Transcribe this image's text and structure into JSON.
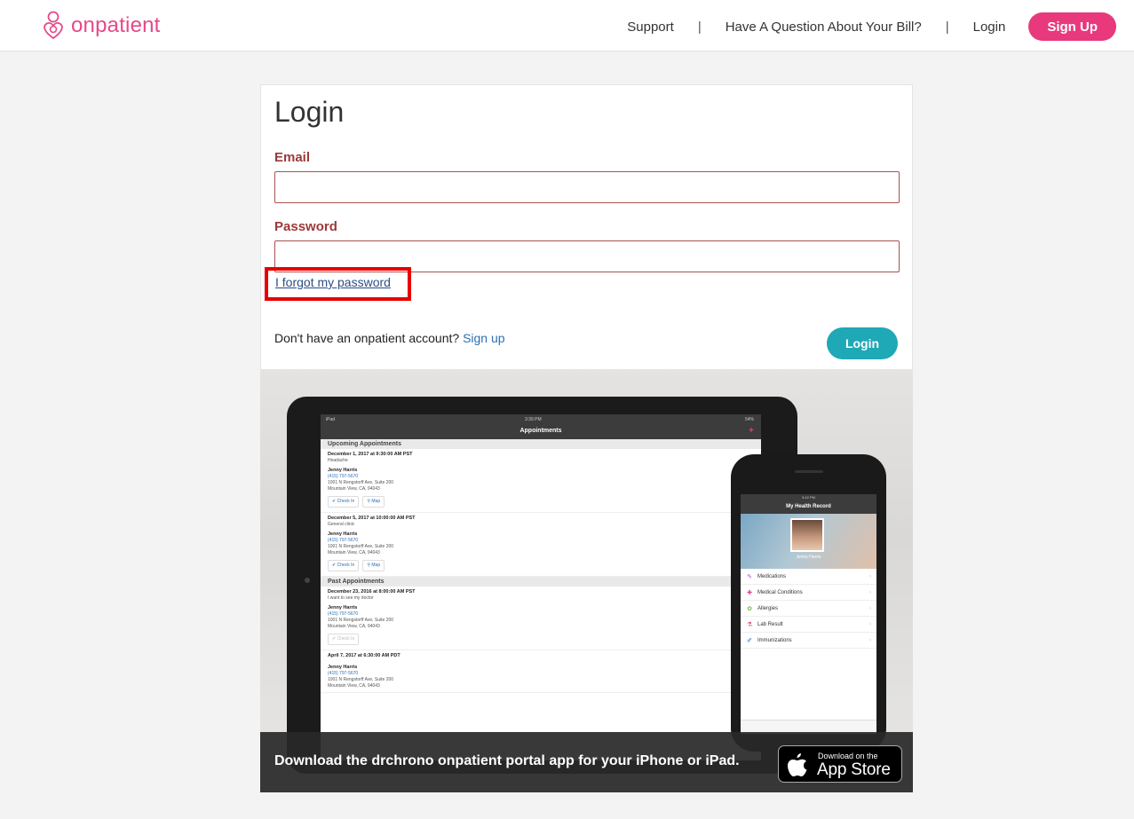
{
  "header": {
    "logo_text": "onpatient",
    "nav": {
      "support": "Support",
      "separator": "|",
      "bill_question": "Have A Question About Your Bill?",
      "login": "Login",
      "signup": "Sign Up"
    }
  },
  "login_form": {
    "title": "Login",
    "email_label": "Email",
    "email_value": "",
    "password_label": "Password",
    "password_value": "",
    "forgot_link": "I forgot my password",
    "no_account_text": "Don't have an onpatient account?",
    "signup_link": "Sign up",
    "login_button": "Login"
  },
  "promo": {
    "banner_text": "Download the drchrono onpatient portal app for your iPhone or iPad.",
    "app_store_small": "Download on the",
    "app_store_big": "App Store",
    "tablet": {
      "status_left": "iPad",
      "time": "3:39 PM",
      "status_right": "54%",
      "nav_title": "Appointments",
      "upcoming_header": "Upcoming Appointments",
      "past_header": "Past Appointments",
      "check_in": "Check In",
      "map": "Map",
      "appointments": [
        {
          "date": "December 1, 2017 at 9:30:00 AM PST",
          "reason": "Headache",
          "doctor": "Jenny Harris",
          "phone": "(415) 797-5670",
          "addr1": "1001 N Rengstorff Ave, Suite 200",
          "addr2": "Mountain View, CA, 94043"
        },
        {
          "date": "December 5, 2017 at 10:00:00 AM PST",
          "reason": "General clinic",
          "doctor": "Jenny Harris",
          "phone": "(415) 797-5670",
          "addr1": "1001 N Rengstorff Ave, Suite 200",
          "addr2": "Mountain View, CA, 94043"
        },
        {
          "date": "December 23, 2016 at 8:00:00 AM PST",
          "reason": "I want to see my doctor",
          "doctor": "Jenny Harris",
          "phone": "(415) 797-5670",
          "addr1": "1001 N Rengstorff Ave, Suite 200",
          "addr2": "Mountain View, CA, 94043"
        },
        {
          "date": "April 7, 2017 at 6:30:00 AM PDT",
          "reason": "",
          "doctor": "Jenny Harris",
          "phone": "(415) 797-5670",
          "addr1": "1001 N Rengstorff Ave, Suite 200",
          "addr2": "Mountain View, CA, 94043"
        }
      ]
    },
    "phone": {
      "time": "3:42 PM",
      "nav_title": "My Health Record",
      "patient_name": "Jenny Harris",
      "items": [
        "Medications",
        "Medical Conditions",
        "Allergies",
        "Lab Result",
        "Immunizations"
      ]
    }
  },
  "colors": {
    "brand_pink": "#e8397d",
    "teal": "#1fa8b5",
    "label_red": "#9b3a3a",
    "highlight_red": "#e60000"
  }
}
